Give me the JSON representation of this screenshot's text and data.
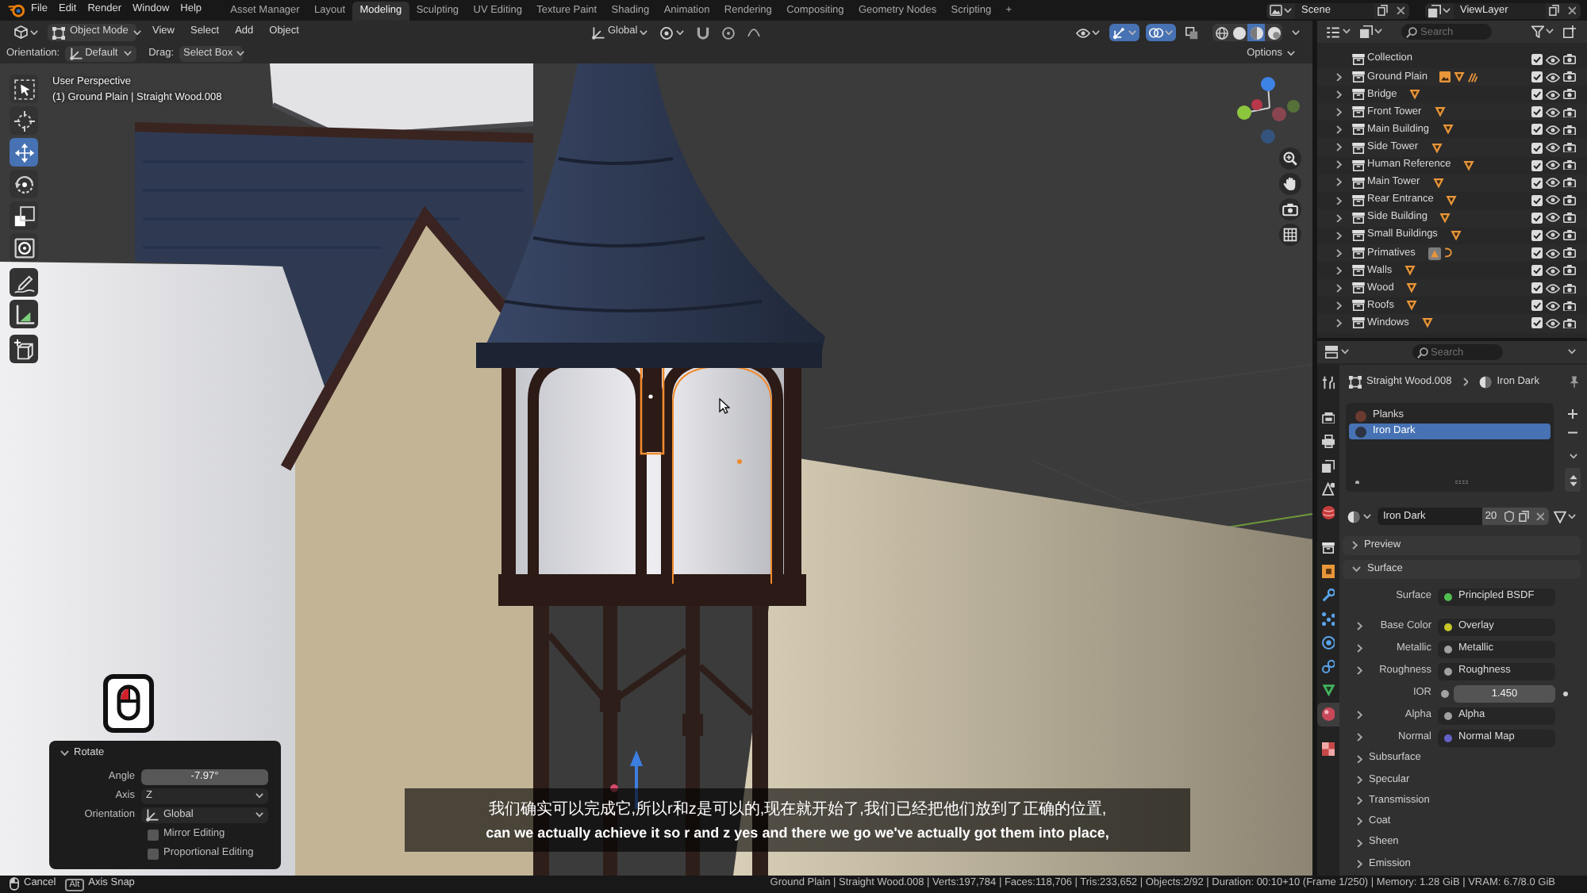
{
  "top_bar": {
    "menus": [
      "File",
      "Edit",
      "Render",
      "Window",
      "Help"
    ],
    "workspaces": [
      {
        "label": "Asset Manager",
        "selected": false
      },
      {
        "label": "Layout",
        "selected": false
      },
      {
        "label": "Modeling",
        "selected": true
      },
      {
        "label": "Sculpting",
        "selected": false
      },
      {
        "label": "UV Editing",
        "selected": false
      },
      {
        "label": "Texture Paint",
        "selected": false
      },
      {
        "label": "Shading",
        "selected": false
      },
      {
        "label": "Animation",
        "selected": false
      },
      {
        "label": "Rendering",
        "selected": false
      },
      {
        "label": "Compositing",
        "selected": false
      },
      {
        "label": "Geometry Nodes",
        "selected": false
      },
      {
        "label": "Scripting",
        "selected": false
      }
    ],
    "add_workspace": "+",
    "scene": "Scene",
    "view_layer": "ViewLayer"
  },
  "viewport": {
    "header": {
      "mode": "Object Mode",
      "menus": [
        "View",
        "Select",
        "Add",
        "Object"
      ],
      "orientation": "Global",
      "toggles": [
        {
          "kind": "gizmo",
          "on": true
        },
        {
          "kind": "overlay",
          "on": true
        },
        {
          "kind": "xray",
          "on": false
        }
      ],
      "shading": [
        {
          "kind": "wireframe",
          "selected": false
        },
        {
          "kind": "solid",
          "selected": false
        },
        {
          "kind": "material",
          "selected": true
        },
        {
          "kind": "rendered",
          "selected": false
        }
      ]
    },
    "tool_settings": {
      "orientation_label": "Orientation:",
      "orientation": "Default",
      "drag_label": "Drag:",
      "drag": "Select Box",
      "options": "Options"
    },
    "tool_groups": [
      [
        {
          "kind": "select_box",
          "selected": false
        },
        {
          "kind": "cursor",
          "selected": false
        },
        {
          "kind": "move",
          "selected": true
        },
        {
          "kind": "rotate",
          "selected": false
        },
        {
          "kind": "scale",
          "selected": false
        },
        {
          "kind": "transform",
          "selected": false
        }
      ],
      [
        {
          "kind": "annotate",
          "selected": false
        },
        {
          "kind": "measure",
          "selected": false
        }
      ],
      [
        {
          "kind": "add_cube",
          "selected": false
        }
      ]
    ],
    "view_name": "User Perspective",
    "object_info": "(1) Ground Plain | Straight Wood.008",
    "redo_panel": {
      "title": "Rotate",
      "expanded": true,
      "fields": [
        {
          "kind": "number",
          "label": "Angle",
          "value": "-7.97°"
        },
        {
          "kind": "dropdown",
          "label": "Axis",
          "value": "Z"
        },
        {
          "kind": "orientation",
          "label": "Orientation",
          "value": "Global"
        }
      ],
      "options": [
        {
          "label": "Mirror Editing",
          "checked": false
        },
        {
          "label": "Proportional Editing",
          "checked": false
        }
      ]
    },
    "subtitles": [
      "我们确实可以完成它,所以r和z是可以的,现在就开始了,我们已经把他们放到了正确的位置,",
      "can we actually achieve it so r and z yes and there we go we've actually got them into place,"
    ]
  },
  "outliner": {
    "search": {
      "placeholder": "Search"
    },
    "items": [
      {
        "name": "Collection",
        "expandable": false,
        "checked": true,
        "selected": false
      },
      {
        "name": "Ground Plain",
        "expandable": true,
        "checked": true,
        "selected": false,
        "contents": [
          {
            "kind": "image"
          },
          {
            "kind": "mesh"
          },
          {
            "kind": "hatch"
          }
        ]
      },
      {
        "name": "Bridge",
        "expandable": true,
        "checked": true,
        "selected": false,
        "contents": [
          {
            "kind": "mesh"
          }
        ]
      },
      {
        "name": "Front Tower",
        "expandable": true,
        "checked": true,
        "selected": false,
        "contents": [
          {
            "kind": "mesh"
          }
        ]
      },
      {
        "name": "Main Building",
        "expandable": true,
        "checked": true,
        "selected": false,
        "contents": [
          {
            "kind": "mesh"
          }
        ]
      },
      {
        "name": "Side Tower",
        "expandable": true,
        "checked": true,
        "selected": false,
        "contents": [
          {
            "kind": "mesh"
          }
        ]
      },
      {
        "name": "Human Reference",
        "expandable": true,
        "checked": true,
        "selected": false,
        "contents": [
          {
            "kind": "mesh"
          }
        ]
      },
      {
        "name": "Main Tower",
        "expandable": true,
        "checked": true,
        "selected": false,
        "contents": [
          {
            "kind": "mesh"
          }
        ]
      },
      {
        "name": "Rear Entrance",
        "expandable": true,
        "checked": true,
        "selected": false,
        "contents": [
          {
            "kind": "mesh"
          }
        ]
      },
      {
        "name": "Side Building",
        "expandable": true,
        "checked": true,
        "selected": false,
        "contents": [
          {
            "kind": "mesh"
          }
        ]
      },
      {
        "name": "Small Buildings",
        "expandable": true,
        "checked": true,
        "selected": false,
        "contents": [
          {
            "kind": "mesh"
          }
        ]
      },
      {
        "name": "Primatives",
        "expandable": true,
        "checked": true,
        "selected": false,
        "contents": [
          {
            "kind": "box"
          },
          {
            "kind": "curve"
          }
        ]
      },
      {
        "name": "Walls",
        "expandable": true,
        "checked": true,
        "selected": false,
        "contents": [
          {
            "kind": "mesh"
          }
        ]
      },
      {
        "name": "Wood",
        "expandable": true,
        "checked": true,
        "selected": false,
        "contents": [
          {
            "kind": "mesh"
          }
        ]
      },
      {
        "name": "Roofs",
        "expandable": true,
        "checked": true,
        "selected": false,
        "contents": [
          {
            "kind": "mesh"
          }
        ]
      },
      {
        "name": "Windows",
        "expandable": true,
        "checked": true,
        "selected": false,
        "contents": [
          {
            "kind": "mesh"
          }
        ]
      }
    ]
  },
  "properties": {
    "search": {
      "placeholder": "Search"
    },
    "tab_groups": [
      [
        {
          "kind": "tool",
          "selected": false
        }
      ],
      [
        {
          "kind": "render",
          "selected": false
        },
        {
          "kind": "output",
          "selected": false
        },
        {
          "kind": "view_layer",
          "selected": false
        },
        {
          "kind": "scene",
          "selected": false
        },
        {
          "kind": "world",
          "selected": false
        }
      ],
      [
        {
          "kind": "collection",
          "selected": false
        },
        {
          "kind": "object",
          "selected": false
        },
        {
          "kind": "modifiers",
          "selected": false
        },
        {
          "kind": "particles",
          "selected": false
        },
        {
          "kind": "physics",
          "selected": false
        },
        {
          "kind": "constraints",
          "selected": false
        },
        {
          "kind": "data",
          "selected": false
        },
        {
          "kind": "material",
          "selected": true
        }
      ],
      [
        {
          "kind": "texture",
          "selected": false
        }
      ]
    ],
    "breadcrumb": [
      "Straight Wood.008",
      "Iron Dark"
    ],
    "material_slots": [
      {
        "name": "Planks",
        "color": "#6b3a30",
        "selected": false
      },
      {
        "name": "Iron Dark",
        "color": "#2d3340",
        "selected": true
      }
    ],
    "material": {
      "name": "Iron Dark",
      "users": "20"
    },
    "panels": [
      {
        "title": "Preview",
        "expanded": false
      },
      {
        "title": "Surface",
        "expanded": true,
        "rows": [
          {
            "kind": "link",
            "label": "Surface",
            "value": "Principled BSDF",
            "color": "#4fbf4f",
            "expandable": false
          },
          {
            "kind": "link",
            "label": "Base Color",
            "value": "Overlay",
            "color": "#c7c729",
            "expandable": true
          },
          {
            "kind": "link",
            "label": "Metallic",
            "value": "Metallic",
            "color": "#a1a1a1",
            "expandable": true
          },
          {
            "kind": "link",
            "label": "Roughness",
            "value": "Roughness",
            "color": "#a1a1a1",
            "expandable": true
          },
          {
            "kind": "number",
            "label": "IOR",
            "value": "1.450",
            "color": "#a1a1a1",
            "expandable": false
          },
          {
            "kind": "link",
            "label": "Alpha",
            "value": "Alpha",
            "color": "#a1a1a1",
            "expandable": true
          },
          {
            "kind": "link",
            "label": "Normal",
            "value": "Normal Map",
            "color": "#6363c7",
            "expandable": true
          }
        ],
        "subpanels": [
          {
            "title": "Subsurface",
            "expanded": false
          },
          {
            "title": "Specular",
            "expanded": false
          },
          {
            "title": "Transmission",
            "expanded": false
          },
          {
            "title": "Coat",
            "expanded": false
          },
          {
            "title": "Sheen",
            "expanded": false
          },
          {
            "title": "Emission",
            "expanded": false
          }
        ]
      }
    ]
  },
  "status_bar": {
    "hints": [
      {
        "kind": "mouse",
        "label": "Cancel"
      },
      {
        "kind": "key",
        "key": "Alt",
        "label": "Axis Snap"
      }
    ],
    "stats": "Ground Plain | Straight Wood.008 | Verts:197,784 | Faces:118,706 | Tris:233,652 | Objects:2/92 | Duration: 00:10+10 (Frame 1/250) | Memory: 1.28 GiB | VRAM: 6.7/8.0 GiB"
  }
}
